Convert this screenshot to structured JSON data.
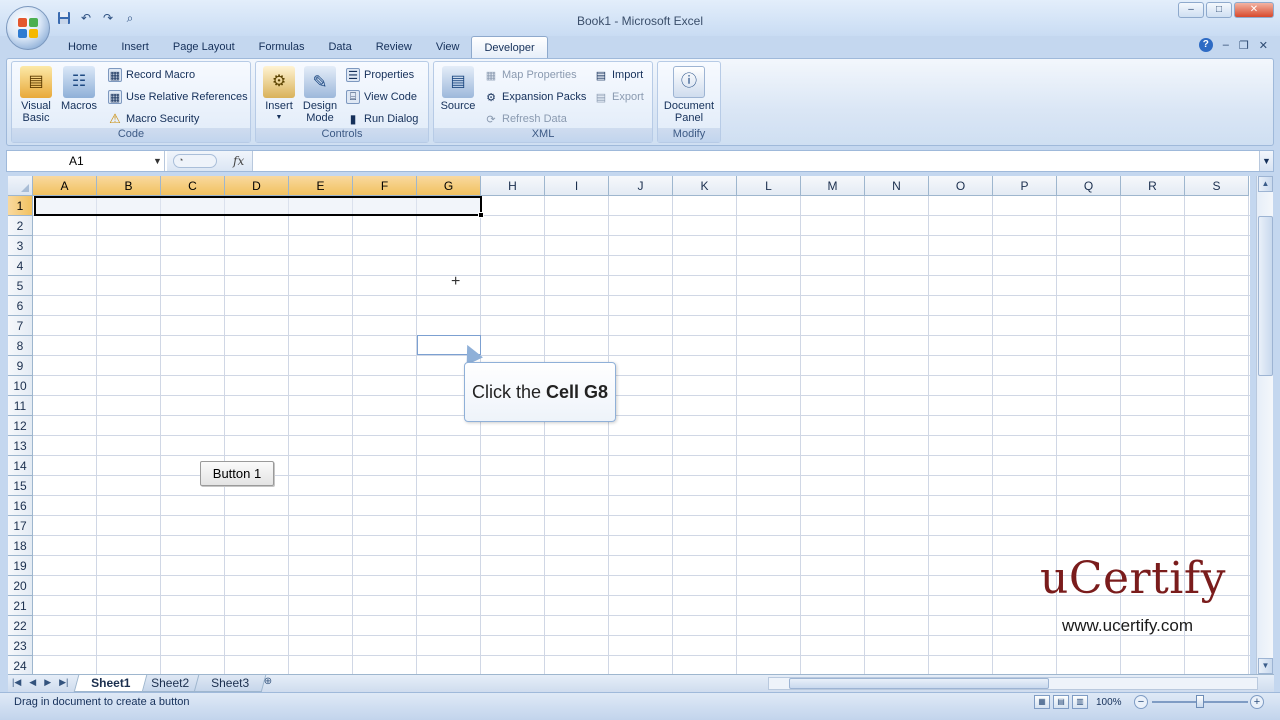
{
  "window": {
    "title": "Book1 - Microsoft Excel",
    "controls": {
      "minimize": "–",
      "maximize": "□",
      "close": "✕"
    }
  },
  "quick_access": [
    "save-icon",
    "undo-icon",
    "redo-icon",
    "print-preview-icon"
  ],
  "tabs": [
    "Home",
    "Insert",
    "Page Layout",
    "Formulas",
    "Data",
    "Review",
    "View",
    "Developer"
  ],
  "active_tab": "Developer",
  "help": {
    "label": "?"
  },
  "ribbon": {
    "code": {
      "label": "Code",
      "visual_basic": "Visual Basic",
      "macros": "Macros",
      "record_macro": "Record Macro",
      "use_relative": "Use Relative References",
      "macro_security": "Macro Security"
    },
    "controls": {
      "label": "Controls",
      "insert": "Insert",
      "design_mode": "Design Mode",
      "properties": "Properties",
      "view_code": "View Code",
      "run_dialog": "Run Dialog"
    },
    "xml": {
      "label": "XML",
      "source": "Source",
      "map_properties": "Map Properties",
      "expansion_packs": "Expansion Packs",
      "refresh_data": "Refresh Data",
      "import": "Import",
      "export": "Export"
    },
    "modify": {
      "label": "Modify",
      "document_panel": "Document Panel"
    }
  },
  "formula_bar": {
    "name_box": "A1",
    "fx": "fx",
    "content": ""
  },
  "grid": {
    "columns": [
      "A",
      "B",
      "C",
      "D",
      "E",
      "F",
      "G",
      "H",
      "I",
      "J",
      "K",
      "L",
      "M",
      "N",
      "O",
      "P",
      "Q",
      "R",
      "S"
    ],
    "selected_columns": [
      "A",
      "B",
      "C",
      "D",
      "E",
      "F",
      "G"
    ],
    "rows": [
      "1",
      "2",
      "3",
      "4",
      "5",
      "6",
      "7",
      "8",
      "9",
      "10",
      "11",
      "12",
      "13",
      "14",
      "15",
      "16",
      "17",
      "18",
      "19",
      "20",
      "21",
      "22",
      "23",
      "24"
    ],
    "selected_row": "1"
  },
  "form_button": {
    "label": "Button 1"
  },
  "callout": {
    "prefix": "Click the ",
    "bold": "Cell G8"
  },
  "watermark": {
    "brand": "uCertify",
    "url": "www.ucertify.com"
  },
  "sheets": [
    "Sheet1",
    "Sheet2",
    "Sheet3"
  ],
  "active_sheet": "Sheet1",
  "status": {
    "message": "Drag in document to create a button",
    "zoom": "100%"
  }
}
